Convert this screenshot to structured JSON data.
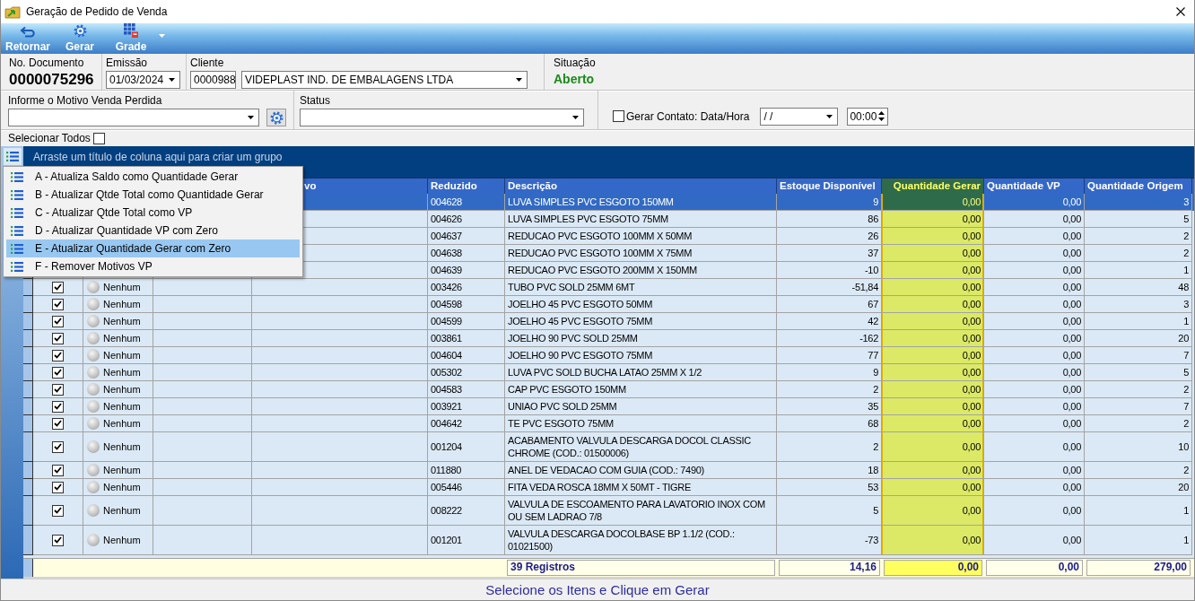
{
  "window": {
    "title": "Geração de Pedido de Venda"
  },
  "toolbar": {
    "buttons": [
      {
        "label": "Retornar",
        "kind": "undo"
      },
      {
        "label": "Gerar",
        "kind": "gear"
      },
      {
        "label": "Grade",
        "kind": "grid"
      }
    ]
  },
  "header": {
    "document": {
      "label": "No. Documento",
      "value": "0000075296"
    },
    "emission": {
      "label": "Emissão",
      "value": "01/03/2024"
    },
    "client": {
      "label": "Cliente",
      "code": "0000988",
      "name": "VIDEPLAST IND. DE EMBALAGENS LTDA"
    },
    "situation": {
      "label": "Situação",
      "value": "Aberto"
    }
  },
  "filters": {
    "lost_reason": {
      "label": "Informe o Motivo Venda Perdida"
    },
    "status": {
      "label": "Status"
    },
    "contact": {
      "label": "Gerar Contato: Data/Hora",
      "checked": false,
      "date": "/ /",
      "time": "00:00"
    }
  },
  "select_all": {
    "label": "Selecionar Todos",
    "checked": false
  },
  "grid": {
    "group_hint": "Arraste um título de coluna aqui para criar um grupo",
    "columns": [
      {
        "label": "vo",
        "highlighted": false
      },
      {
        "label": "Reduzido",
        "highlighted": false
      },
      {
        "label": "Descrição",
        "highlighted": false
      },
      {
        "label": "Estoque Disponível",
        "highlighted": false
      },
      {
        "label": "Quantidade Gerar",
        "highlighted": true
      },
      {
        "label": "Quantidade VP",
        "highlighted": false
      },
      {
        "label": "Quantidade Origem",
        "highlighted": false
      }
    ],
    "rows": [
      {
        "selected": true,
        "code": "004628",
        "description": "LUVA SIMPLES PVC ESGOTO 150MM",
        "stock": "9",
        "qty_generate": "0,00",
        "qty_vp": "0,00",
        "qty_origin": "3"
      },
      {
        "selected": false,
        "code": "004626",
        "description": "LUVA SIMPLES PVC ESGOTO 75MM",
        "stock": "86",
        "qty_generate": "0,00",
        "qty_vp": "0,00",
        "qty_origin": "5"
      },
      {
        "selected": false,
        "code": "004637",
        "description": "REDUCAO PVC ESGOTO 100MM X 50MM",
        "stock": "26",
        "qty_generate": "0,00",
        "qty_vp": "0,00",
        "qty_origin": "2"
      },
      {
        "selected": false,
        "code": "004638",
        "description": "REDUCAO PVC ESGOTO 100MM X 75MM",
        "stock": "37",
        "qty_generate": "0,00",
        "qty_vp": "0,00",
        "qty_origin": "2"
      },
      {
        "selected": false,
        "code": "004639",
        "description": "REDUCAO PVC ESGOTO 200MM X 150MM",
        "stock": "-10",
        "qty_generate": "0,00",
        "qty_vp": "0,00",
        "qty_origin": "1"
      },
      {
        "selected": false,
        "checked": true,
        "status": "Nenhum",
        "code": "003426",
        "description": "TUBO PVC SOLD 25MM 6MT",
        "stock": "-51,84",
        "qty_generate": "0,00",
        "qty_vp": "0,00",
        "qty_origin": "48"
      },
      {
        "selected": false,
        "checked": true,
        "status": "Nenhum",
        "code": "004598",
        "description": "JOELHO 45 PVC ESGOTO 50MM",
        "stock": "67",
        "qty_generate": "0,00",
        "qty_vp": "0,00",
        "qty_origin": "3"
      },
      {
        "selected": false,
        "checked": true,
        "status": "Nenhum",
        "code": "004599",
        "description": "JOELHO 45 PVC ESGOTO 75MM",
        "stock": "42",
        "qty_generate": "0,00",
        "qty_vp": "0,00",
        "qty_origin": "1"
      },
      {
        "selected": false,
        "checked": true,
        "status": "Nenhum",
        "code": "003861",
        "description": "JOELHO 90 PVC SOLD 25MM",
        "stock": "-162",
        "qty_generate": "0,00",
        "qty_vp": "0,00",
        "qty_origin": "20"
      },
      {
        "selected": false,
        "checked": true,
        "status": "Nenhum",
        "code": "004604",
        "description": "JOELHO 90 PVC ESGOTO 75MM",
        "stock": "77",
        "qty_generate": "0,00",
        "qty_vp": "0,00",
        "qty_origin": "7"
      },
      {
        "selected": false,
        "checked": true,
        "status": "Nenhum",
        "code": "005302",
        "description": "LUVA PVC SOLD BUCHA LATAO 25MM X 1/2",
        "stock": "9",
        "qty_generate": "0,00",
        "qty_vp": "0,00",
        "qty_origin": "5"
      },
      {
        "selected": false,
        "checked": true,
        "status": "Nenhum",
        "code": "004583",
        "description": "CAP PVC ESGOTO 150MM",
        "stock": "2",
        "qty_generate": "0,00",
        "qty_vp": "0,00",
        "qty_origin": "2"
      },
      {
        "selected": false,
        "checked": true,
        "status": "Nenhum",
        "code": "003921",
        "description": "UNIAO PVC SOLD 25MM",
        "stock": "35",
        "qty_generate": "0,00",
        "qty_vp": "0,00",
        "qty_origin": "7"
      },
      {
        "selected": false,
        "checked": true,
        "status": "Nenhum",
        "code": "004642",
        "description": "TE PVC ESGOTO 75MM",
        "stock": "68",
        "qty_generate": "0,00",
        "qty_vp": "0,00",
        "qty_origin": "2"
      },
      {
        "selected": false,
        "checked": true,
        "status": "Nenhum",
        "code": "001204",
        "description": "ACABAMENTO VALVULA DESCARGA DOCOL CLASSIC CHROME (COD.: 01500006)",
        "stock": "2",
        "qty_generate": "0,00",
        "qty_vp": "0,00",
        "qty_origin": "10"
      },
      {
        "selected": false,
        "checked": true,
        "status": "Nenhum",
        "code": "011880",
        "description": "ANEL DE VEDACAO COM GUIA (COD.: 7490)",
        "stock": "18",
        "qty_generate": "0,00",
        "qty_vp": "0,00",
        "qty_origin": "2"
      },
      {
        "selected": false,
        "checked": true,
        "status": "Nenhum",
        "code": "005446",
        "description": "FITA VEDA ROSCA 18MM X 50MT - TIGRE",
        "stock": "53",
        "qty_generate": "0,00",
        "qty_vp": "0,00",
        "qty_origin": "20"
      },
      {
        "selected": false,
        "checked": true,
        "status": "Nenhum",
        "code": "008222",
        "description": "VALVULA DE ESCOAMENTO PARA LAVATORIO INOX COM OU SEM LADRAO 7/8",
        "stock": "5",
        "qty_generate": "0,00",
        "qty_vp": "0,00",
        "qty_origin": "1"
      },
      {
        "selected": false,
        "checked": true,
        "status": "Nenhum",
        "code": "001201",
        "description": "VALVULA DESCARGA DOCOLBASE BP 1.1/2 (COD.: 01021500)",
        "stock": "-73",
        "qty_generate": "0,00",
        "qty_vp": "0,00",
        "qty_origin": "1"
      }
    ],
    "footer": {
      "count": "39 Registros",
      "totals": [
        "14,16",
        "0,00",
        "0,00",
        "279,00"
      ]
    }
  },
  "context_menu": {
    "items": [
      {
        "label": "A - Atualiza Saldo como Quantidade Gerar",
        "selected": false
      },
      {
        "label": "B - Atualizar Qtde Total como Quantidade Gerar",
        "selected": false
      },
      {
        "label": "C - Atualizar Qtde Total como VP",
        "selected": false
      },
      {
        "label": "D - Atualizar Quantidade VP com Zero",
        "selected": false
      },
      {
        "label": "E - Atualizar Quantidade Gerar com Zero",
        "selected": true
      },
      {
        "label": "F - Remover Motivos VP",
        "selected": false
      }
    ]
  },
  "status_bar": {
    "message": "Selecione os Itens e Clique em Gerar"
  }
}
